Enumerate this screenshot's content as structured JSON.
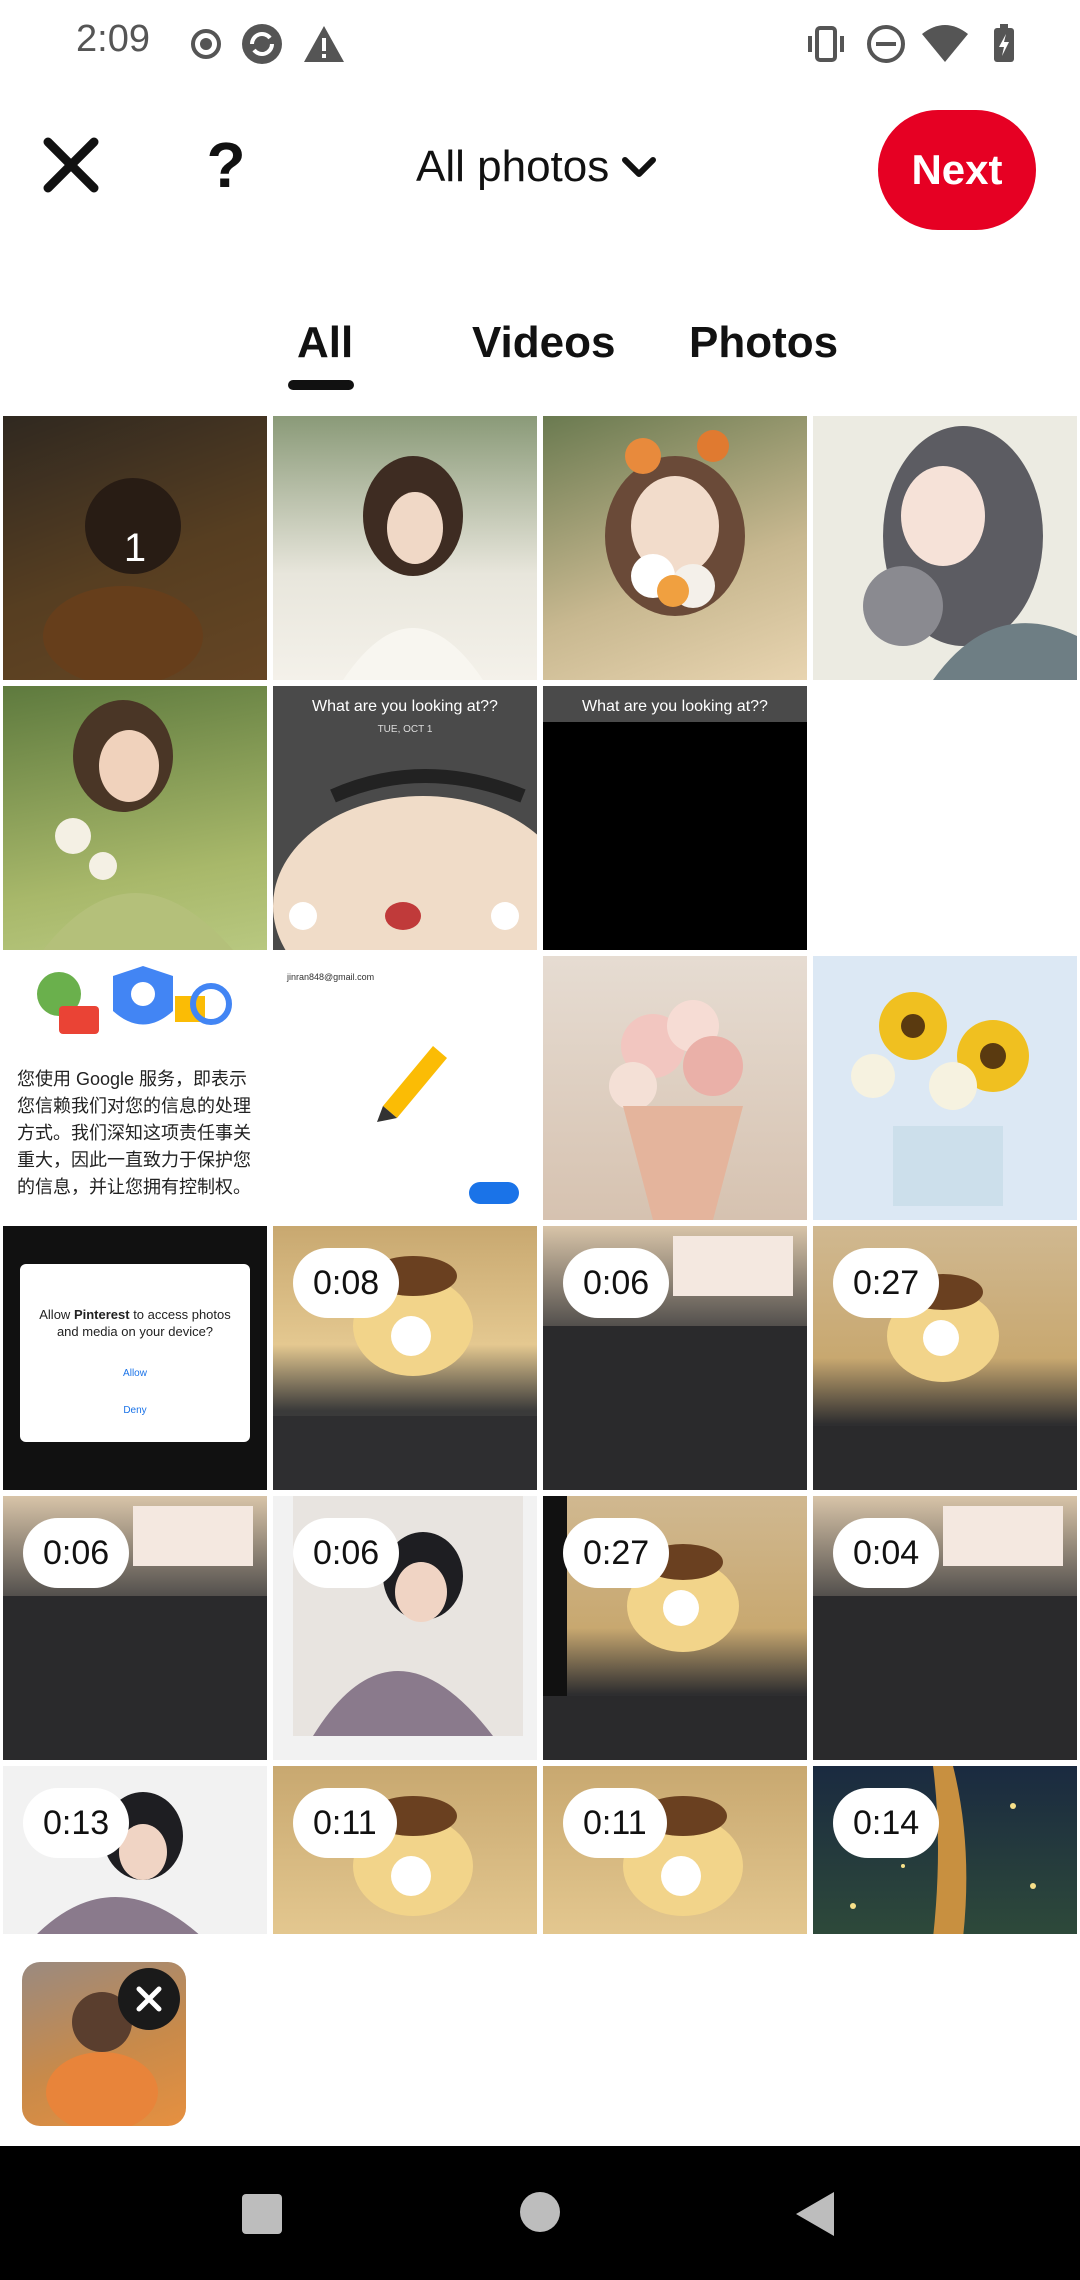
{
  "status_bar": {
    "time": "2:09",
    "left_icons": [
      "record-icon",
      "sync-icon",
      "warning-icon"
    ],
    "right_icons": [
      "vibrate-icon",
      "dnd-icon",
      "wifi-icon",
      "battery-icon"
    ]
  },
  "header": {
    "close_icon": "close-icon",
    "help_label": "?",
    "album_title": "All photos",
    "album_chevron": "chevron-down-icon",
    "next_label": "Next",
    "accent_color": "#e60023"
  },
  "tabs": [
    {
      "label": "All",
      "selected": true
    },
    {
      "label": "Videos",
      "selected": false
    },
    {
      "label": "Photos",
      "selected": false
    }
  ],
  "grid": {
    "selected_badge": "1",
    "screenshot_text_1": "What are you looking at??",
    "screenshot_date": "TUE, OCT 1",
    "screenshot_text_2": "What are you looking at??",
    "google_email": "jinran848@gmail.com",
    "google_policy_text": "您使用 Google 服务，即表示您信赖我们对您的信息的处理方式。我们深知这项责任事关重大，因此一直致力于保护您的信息，并让您拥有控制权。",
    "permission_title_prefix": "Allow ",
    "permission_app": "Pinterest",
    "permission_title_suffix": " to access photos and media on your device?",
    "permission_allow": "Allow",
    "permission_deny": "Deny",
    "durations": [
      "0:08",
      "0:06",
      "0:27",
      "0:06",
      "0:06",
      "0:27",
      "0:04",
      "0:13",
      "0:11",
      "0:11",
      "0:14"
    ]
  },
  "tray": {
    "remove_icon": "close-icon"
  },
  "nav_bar": {
    "icons": [
      "recents-square-icon",
      "home-circle-icon",
      "back-triangle-icon"
    ]
  }
}
